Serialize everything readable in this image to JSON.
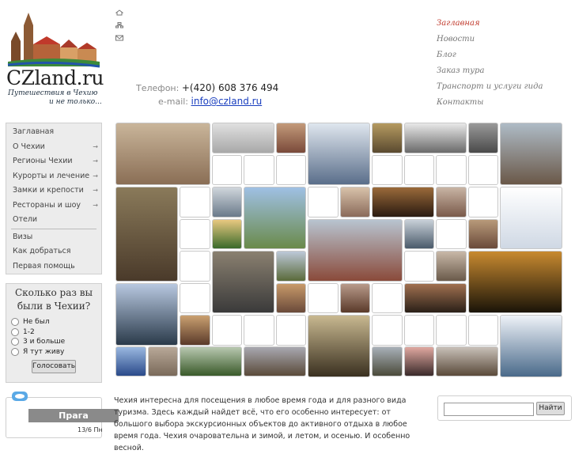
{
  "logo": {
    "text": "CZland.ru",
    "tagline_1": "Путешествия в Чехию",
    "tagline_2": "и не только..."
  },
  "top_icons": [
    "home-icon",
    "sitemap-icon",
    "mail-icon"
  ],
  "contact": {
    "phone_label": "Телефон:",
    "phone": "+(420) 608 376 494",
    "email_label": "e-mail:",
    "email": "info@czland.ru"
  },
  "topnav": [
    "Заглавная",
    "Новости",
    "Блог",
    "Заказ тура",
    "Транспорт и услуги гида",
    "Контакты"
  ],
  "sidebar": {
    "items_a": [
      {
        "label": "Заглавная",
        "arrow": false
      },
      {
        "label": "О Чехии",
        "arrow": true
      },
      {
        "label": "Регионы Чехии",
        "arrow": true
      },
      {
        "label": "Курорты и лечение",
        "arrow": true
      },
      {
        "label": "Замки и крепости",
        "arrow": true
      },
      {
        "label": "Рестораны и шоу",
        "arrow": true
      },
      {
        "label": "Отели",
        "arrow": false
      }
    ],
    "items_b": [
      {
        "label": "Визы"
      },
      {
        "label": "Как добраться"
      },
      {
        "label": "Первая помощь"
      }
    ],
    "arrow_glyph": "→"
  },
  "poll": {
    "question": "Сколько раз вы были в Чехии?",
    "options": [
      "Не был",
      "1-2",
      "3 и больше",
      "Я тут живу"
    ],
    "vote_label": "Голосовать"
  },
  "weather": {
    "city": "Прага",
    "date": "13/6 Пн"
  },
  "intro": "Чехия интересна для посещения в любое время года и для разного вида туризма. Здесь каждый найдет  всё, что его особенно интересует: от большого выбора экскурсионных объектов до активного отдыха в любое время года. Чехия очаровательна и зимой, и летом, и осенью. И особенно весной.",
  "search": {
    "placeholder": "",
    "button": "Найти"
  },
  "colors": {
    "accent": "#c0392b",
    "sidebar_bg": "#ececec",
    "link": "#1a3fbf"
  }
}
